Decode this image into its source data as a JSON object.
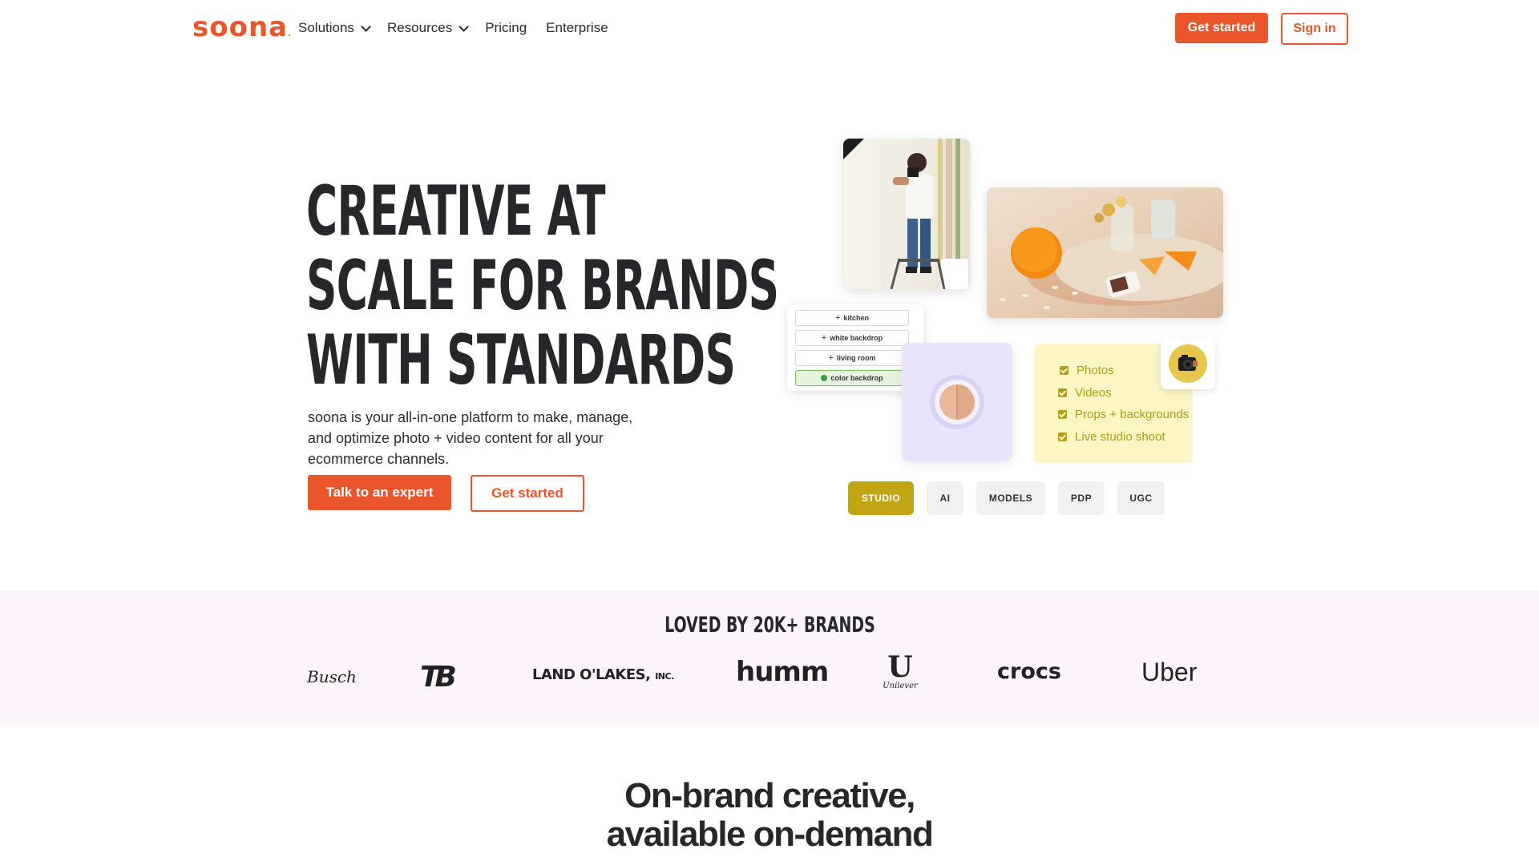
{
  "nav": {
    "logo": "soona",
    "menu": [
      {
        "label": "Solutions",
        "dropdown": true
      },
      {
        "label": "Resources",
        "dropdown": true
      },
      {
        "label": "Pricing",
        "dropdown": false
      },
      {
        "label": "Enterprise",
        "dropdown": false
      }
    ],
    "get_started": "Get started",
    "sign_in": "Sign in"
  },
  "hero": {
    "headline": [
      "CREATIVE AT",
      "SCALE FOR BRANDS",
      "WITH STANDARDS"
    ],
    "subcopy": "soona is your all-in-one platform to make, manage, and optimize photo + video content for all your ecommerce channels.",
    "cta_primary": "Talk to an expert",
    "cta_secondary": "Get started"
  },
  "collage": {
    "tags": [
      {
        "label": "kitchen",
        "state": "add"
      },
      {
        "label": "white backdrop",
        "state": "add"
      },
      {
        "label": "living room",
        "state": "add"
      },
      {
        "label": "color backdrop",
        "state": "selected"
      }
    ],
    "checklist": [
      "Photos",
      "Videos",
      "Props + backgrounds",
      "Live studio shoot"
    ],
    "chips": [
      {
        "label": "STUDIO",
        "active": true
      },
      {
        "label": "AI",
        "active": false
      },
      {
        "label": "MODELS",
        "active": false
      },
      {
        "label": "PDP",
        "active": false
      },
      {
        "label": "UGC",
        "active": false
      }
    ]
  },
  "brands": {
    "title": "LOVED BY 20K+ BRANDS",
    "logos": {
      "busch": "Busch",
      "tb": "TB",
      "landolakes": "LAND O'LAKES,",
      "landolakes_suffix": "INC.",
      "humm": "humm",
      "unilever_mark": "U",
      "unilever": "Unilever",
      "crocs": "crocs",
      "uber": "Uber"
    }
  },
  "section": {
    "title_line1": "On-brand creative,",
    "title_line2": "available on-demand"
  },
  "colors": {
    "brand": "#e9562c",
    "chip_active": "#c2a514",
    "strip_bg": "#fdf3fa",
    "checklist_bg": "#fbf6c4"
  }
}
